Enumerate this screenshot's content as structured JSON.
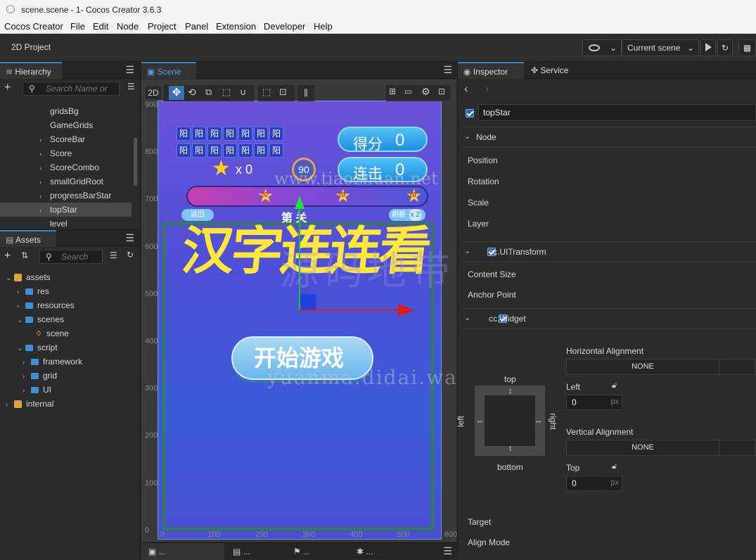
{
  "window": {
    "title": "scene.scene - 1- Cocos Creator 3.6.3"
  },
  "menu": [
    "Cocos Creator",
    "File",
    "Edit",
    "Node",
    "Project",
    "Panel",
    "Extension",
    "Developer",
    "Help"
  ],
  "toolbar": {
    "project": "2D Project",
    "scene_select": "Current scene"
  },
  "hierarchy": {
    "title": "Hierarchy",
    "search_placeholder": "Search Name or",
    "items": [
      {
        "label": "gridsBg",
        "expandable": false
      },
      {
        "label": "GameGrids",
        "expandable": false
      },
      {
        "label": "ScoreBar",
        "expandable": true
      },
      {
        "label": "Score",
        "expandable": true
      },
      {
        "label": "ScoreCombo",
        "expandable": true
      },
      {
        "label": "smallGridRoot",
        "expandable": true
      },
      {
        "label": "progressBarStar",
        "expandable": true
      },
      {
        "label": "topStar",
        "expandable": true,
        "selected": true
      },
      {
        "label": "level",
        "expandable": false
      }
    ]
  },
  "assets": {
    "title": "Assets",
    "search_placeholder": "Search",
    "items": [
      "assets",
      "res",
      "resources",
      "scenes",
      "scene",
      "script",
      "framework",
      "grid",
      "UI",
      "internal"
    ]
  },
  "scene": {
    "title": "Scene",
    "mode": "2D",
    "y_ticks": [
      "900",
      "800",
      "700",
      "600",
      "500",
      "400",
      "300",
      "200",
      "100",
      "0"
    ],
    "x_ticks": [
      "0",
      "100",
      "200",
      "300",
      "400",
      "500",
      "600"
    ],
    "game": {
      "grid_char": "阳",
      "score_label": "得分",
      "score_value": "0",
      "combo_label": "连击",
      "combo_value": "0",
      "star_count": "x 0",
      "timer": "90",
      "star_marks": [
        "20",
        "20",
        "20"
      ],
      "back_btn": "返回",
      "level_text": "第 关",
      "refresh_btn": "刷新",
      "refresh_count": "x 2",
      "title": "汉字连连看",
      "start_btn": "开始游戏"
    },
    "watermark_top": "www.tiaozhuan.net",
    "watermark_mid": "源码地带",
    "watermark_bottom": "yuanma.didai.wang"
  },
  "bottom_tabs": [
    "...",
    "...",
    "...",
    "..."
  ],
  "inspector": {
    "tabs": [
      "Inspector",
      "Service"
    ],
    "node_name": "topStar",
    "sections": {
      "node": "Node",
      "ui_transform": "cc.UITransform",
      "widget": "cc.Widget"
    },
    "node_props": [
      "Position",
      "Rotation",
      "Scale",
      "Layer"
    ],
    "transform_props": [
      "Content Size",
      "Anchor Point"
    ],
    "widget": {
      "h_align_label": "Horizontal Alignment",
      "h_align_value": "NONE",
      "left_label": "Left",
      "left_value": "0",
      "unit": "px",
      "v_align_label": "Vertical Alignment",
      "v_align_value": "NONE",
      "top_label": "Top",
      "top_value": "0",
      "diagram": {
        "top": "top",
        "bottom": "bottom",
        "left": "left",
        "right": "right"
      }
    },
    "bottom_props": [
      "Target",
      "Align Mode"
    ]
  }
}
